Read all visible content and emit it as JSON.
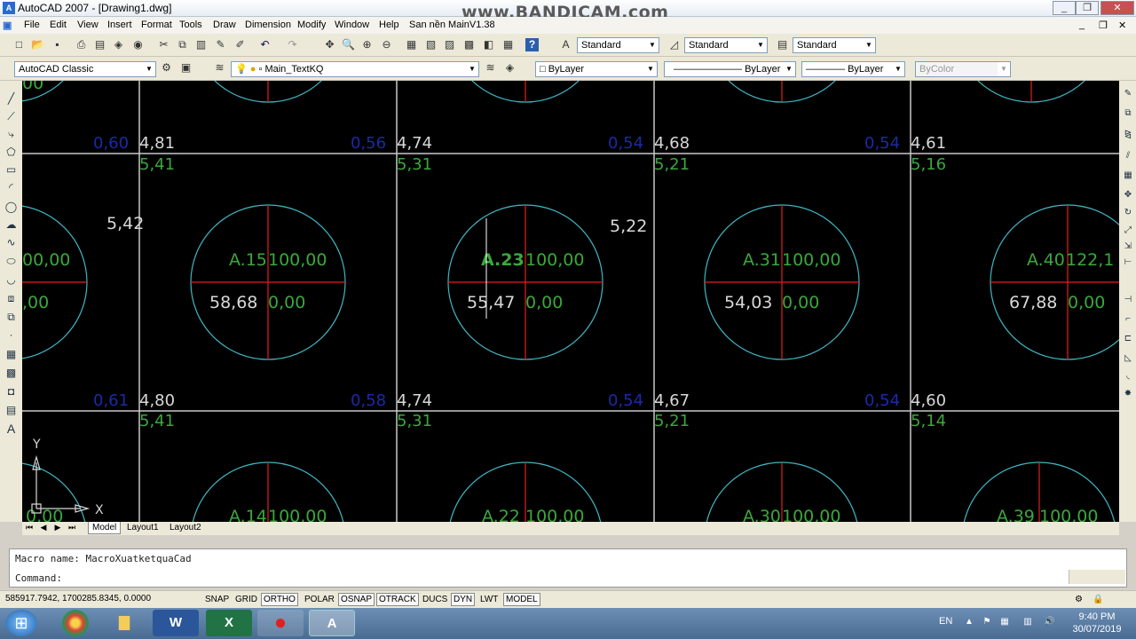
{
  "window": {
    "title": "AutoCAD 2007 - [Drawing1.dwg]",
    "watermark": "www.BANDICAM.com",
    "app_icon": "A"
  },
  "menu": [
    "File",
    "Edit",
    "View",
    "Insert",
    "Format",
    "Tools",
    "Draw",
    "Dimension",
    "Modify",
    "Window",
    "Help",
    "San nền MainV1.38"
  ],
  "toolbar": {
    "text_style": "Standard",
    "dim_style": "Standard",
    "table_style": "Standard",
    "workspace": "AutoCAD Classic",
    "layer": "Main_TextKQ",
    "color": "ByLayer",
    "linetype": "ByLayer",
    "lineweight": "ByLayer",
    "plotstyle": "ByColor"
  },
  "drawing": {
    "row1": [
      {
        "blue": "0,60",
        "white": "4,81",
        "green": "5,41"
      },
      {
        "blue": "0,56",
        "white": "4,74",
        "green": "5,31"
      },
      {
        "blue": "0,54",
        "white": "4,68",
        "green": "5,21"
      },
      {
        "blue": "0,54",
        "white": "4,61",
        "green": "5,16"
      }
    ],
    "row2": [
      {
        "blue": "0,61",
        "white": "4,80",
        "green": "5,41"
      },
      {
        "blue": "0,58",
        "white": "4,74",
        "green": "5,31"
      },
      {
        "blue": "0,54",
        "white": "4,67",
        "green": "5,21"
      },
      {
        "blue": "0,54",
        "white": "4,60",
        "green": "5,14"
      }
    ],
    "mid_labels": [
      "5,42",
      "5,22"
    ],
    "circles": [
      {
        "name": "A.15",
        "val": "100,00",
        "depth": "58,68",
        "fill": "0,00"
      },
      {
        "name": "A.23",
        "val": "100,00",
        "depth": "55,47",
        "fill": "0,00"
      },
      {
        "name": "A.31",
        "val": "100,00",
        "depth": "54,03",
        "fill": "0,00"
      },
      {
        "name": "A.40",
        "val": "122,1",
        "depth": "67,88",
        "fill": "0,00"
      }
    ],
    "left_partial": {
      "top": "00,00",
      "bottom": ",00",
      "top_edge": "00"
    },
    "bottom_circles": [
      {
        "name": "A.14",
        "val": "100,00"
      },
      {
        "name": "A.22",
        "val": "100,00"
      },
      {
        "name": "A.30",
        "val": "100,00"
      },
      {
        "name": "A.39",
        "val": "100,00"
      }
    ],
    "bottom_left": "0,00",
    "ucs": {
      "x": "X",
      "y": "Y"
    }
  },
  "tabs": [
    "Model",
    "Layout1",
    "Layout2"
  ],
  "command": {
    "line1": "Macro name: MacroXuatketquaCad",
    "line2": "Command:"
  },
  "status": {
    "coords": "585917.7942, 1700285.8345, 0.0000",
    "buttons": [
      "SNAP",
      "GRID",
      "ORTHO",
      "POLAR",
      "OSNAP",
      "OTRACK",
      "DUCS",
      "DYN",
      "LWT",
      "MODEL"
    ]
  },
  "taskbar": {
    "lang": "EN",
    "time": "9:40 PM",
    "date": "30/07/2019",
    "apps": [
      "Chrome",
      "Explorer",
      "Word",
      "Excel",
      "Record",
      "AutoCAD"
    ]
  }
}
